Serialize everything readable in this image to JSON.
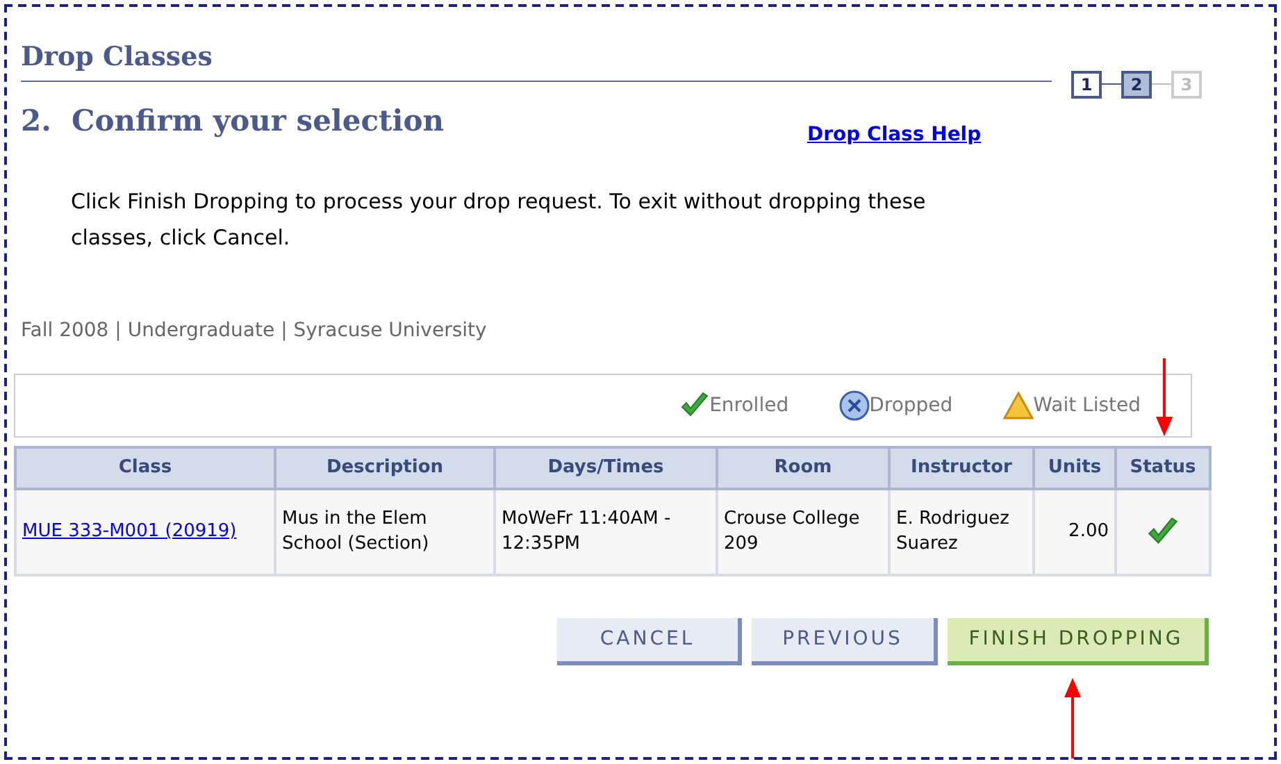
{
  "page_title": "Drop Classes",
  "steps": [
    {
      "label": "1",
      "selected": false,
      "disabled": false
    },
    {
      "label": "2",
      "selected": true,
      "disabled": false
    },
    {
      "label": "3",
      "selected": false,
      "disabled": true
    }
  ],
  "heading": "2.  Confirm your selection",
  "help_link": "Drop Class Help",
  "instructions": "Click Finish Dropping to process your drop request. To exit without dropping these classes, click Cancel.",
  "term": "Fall 2008 | Undergraduate | Syracuse University",
  "legend": [
    {
      "kind": "enrolled",
      "label": "Enrolled"
    },
    {
      "kind": "dropped",
      "label": "Dropped"
    },
    {
      "kind": "waitlisted",
      "label": "Wait Listed"
    }
  ],
  "table": {
    "columns": [
      "Class",
      "Description",
      "Days/Times",
      "Room",
      "Instructor",
      "Units",
      "Status"
    ],
    "rows": [
      {
        "class": "MUE 333-M001 (20919)",
        "description": "Mus in the Elem School (Section)",
        "days_times": "MoWeFr 11:40AM - 12:35PM",
        "room": "Crouse College 209",
        "instructor": "E. Rodriguez Suarez",
        "units": "2.00",
        "kind": "enrolled"
      }
    ]
  },
  "buttons": [
    {
      "label": "CANCEL",
      "kind": "secondary"
    },
    {
      "label": "PREVIOUS",
      "kind": "secondary"
    },
    {
      "label": "FINISH DROPPING",
      "kind": "primary"
    }
  ]
}
